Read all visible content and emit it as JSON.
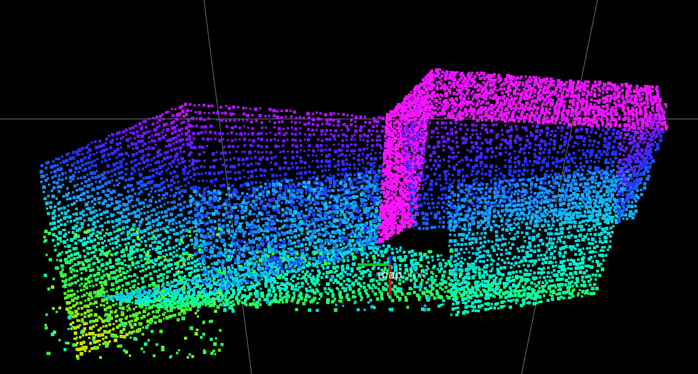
{
  "viewer": {
    "background_color": "#000000",
    "grid_line_color": "#8c8c8c",
    "frames": [
      {
        "label": "map",
        "icon": "axes-icon"
      },
      {
        "label": "link",
        "icon": "axes-icon"
      }
    ],
    "axis_colors": {
      "x": "#d01010",
      "y": "#12c412",
      "z": "#2a2aff"
    },
    "pointcloud": {
      "colormap": [
        "#c8e600",
        "#32ff32",
        "#00ffc8",
        "#14aaff",
        "#1e32ff",
        "#8214ff",
        "#ff14ff"
      ],
      "color_by": "height"
    }
  }
}
